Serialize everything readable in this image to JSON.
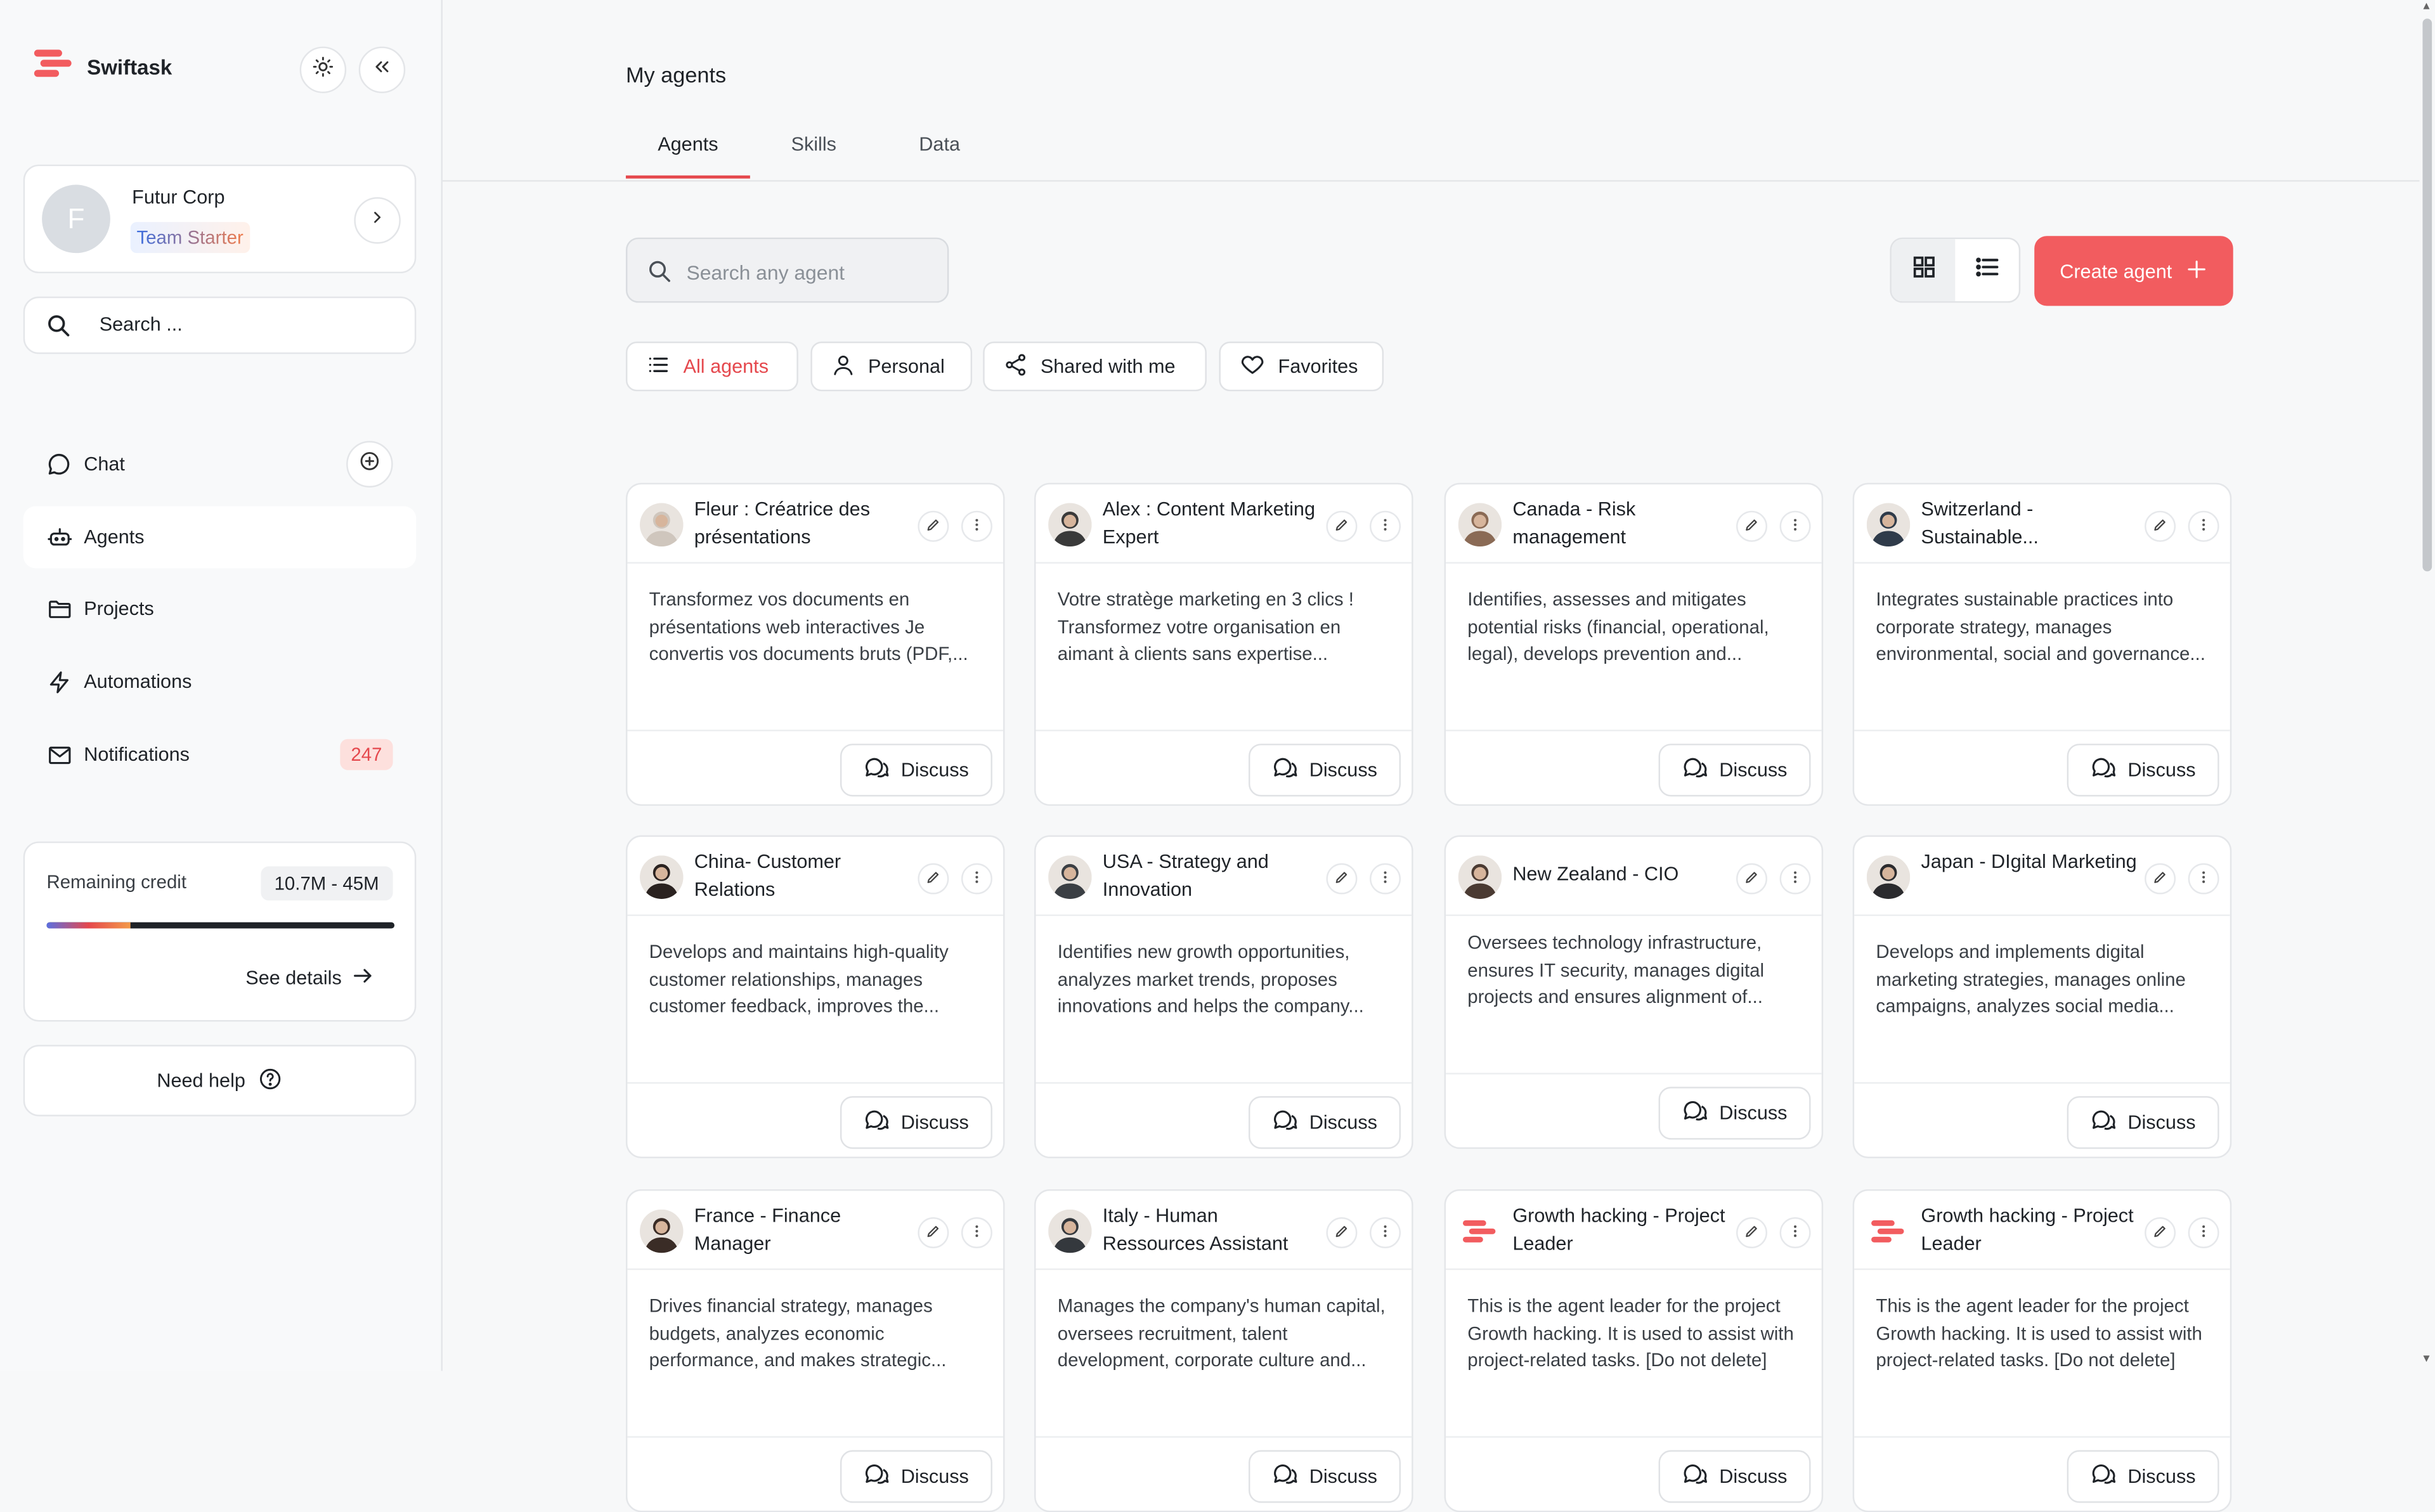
{
  "brand": {
    "name": "Swiftask"
  },
  "org": {
    "initial": "F",
    "name": "Futur Corp",
    "plan": "Team Starter"
  },
  "sidebar_search": {
    "placeholder": "Search ..."
  },
  "nav": {
    "chat": "Chat",
    "agents": "Agents",
    "projects": "Projects",
    "automations": "Automations",
    "notifications": "Notifications",
    "notifications_count": "247"
  },
  "credit": {
    "label": "Remaining credit",
    "value": "10.7M - 45M",
    "used_fraction": 0.24,
    "details_label": "See details"
  },
  "help": {
    "label": "Need help"
  },
  "page": {
    "title": "My agents"
  },
  "tabs": [
    {
      "label": "Agents"
    },
    {
      "label": "Skills"
    },
    {
      "label": "Data"
    }
  ],
  "agent_search": {
    "placeholder": "Search any agent"
  },
  "create_button": {
    "label": "Create agent"
  },
  "filters": [
    {
      "label": "All agents"
    },
    {
      "label": "Personal"
    },
    {
      "label": "Shared with me"
    },
    {
      "label": "Favorites"
    }
  ],
  "discuss_label": "Discuss",
  "cards": [
    {
      "title": "Fleur : Créatrice des présentations",
      "description": "Transformez vos documents en présentations web interactives Je convertis vos documents bruts (PDF,...",
      "avatar": "person",
      "tone": "#cfc6bd"
    },
    {
      "title": "Alex : Content Marketing Expert",
      "description": "Votre stratège marketing en 3 clics ! Transformez votre organisation en aimant à clients sans expertise...",
      "avatar": "person",
      "tone": "#3a3a3a"
    },
    {
      "title": "Canada - Risk management",
      "description": "Identifies, assesses and mitigates potential risks (financial, operational, legal), develops prevention and...",
      "avatar": "person",
      "tone": "#8a6a55"
    },
    {
      "title": "Switzerland - Sustainable...",
      "description": "Integrates sustainable practices into corporate strategy, manages environmental, social and governance...",
      "avatar": "person",
      "tone": "#2f3b4a"
    },
    {
      "title": "China- Customer Relations",
      "description": "Develops and maintains high-quality customer relationships, manages customer feedback, improves the...",
      "avatar": "person",
      "tone": "#2a2220"
    },
    {
      "title": "USA - Strategy and Innovation",
      "description": "Identifies new growth opportunities, analyzes market trends, proposes innovations and helps the company...",
      "avatar": "person",
      "tone": "#3b3f44"
    },
    {
      "title": "New Zealand - CIO",
      "description": "Oversees technology infrastructure, ensures IT security, manages digital projects and ensures alignment of...",
      "avatar": "person",
      "tone": "#4a3a32"
    },
    {
      "title": "Japan - DIgital Marketing",
      "description": "Develops and implements digital marketing strategies, manages online campaigns, analyzes social media...",
      "avatar": "person",
      "tone": "#2b2b2e"
    },
    {
      "title": "France - Finance Manager",
      "description": "Drives financial strategy, manages budgets, analyzes economic performance, and makes strategic...",
      "avatar": "person",
      "tone": "#3a2c26"
    },
    {
      "title": "Italy - Human Ressources Assistant",
      "description": "Manages the company's human capital, oversees recruitment, talent development, corporate culture and...",
      "avatar": "person",
      "tone": "#34383d"
    },
    {
      "title": "Growth hacking - Project Leader",
      "description": "This is the agent leader for the project Growth hacking. It is used to assist with project-related tasks. [Do not delete]",
      "avatar": "logo",
      "tone": "#f25c5f"
    },
    {
      "title": "Growth hacking - Project Leader",
      "description": "This is the agent leader for the project Growth hacking. It is used to assist with project-related tasks. [Do not delete]",
      "avatar": "logo",
      "tone": "#f25c5f"
    }
  ],
  "colors": {
    "accent": "#e5484d",
    "primary_button": "#f25c5f",
    "sidebar_bg": "#f8f9fa"
  },
  "icons": {
    "theme": "sun-icon",
    "collapse": "double-chevron-left-icon",
    "search": "search-icon",
    "chat": "chat-bubble-icon",
    "new_chat": "plus-circle-icon",
    "agents": "robot-icon",
    "projects": "folder-icon",
    "automations": "automation-icon",
    "notifications": "mail-icon",
    "help": "question-circle-icon",
    "grid": "grid-icon",
    "list": "list-icon"
  }
}
